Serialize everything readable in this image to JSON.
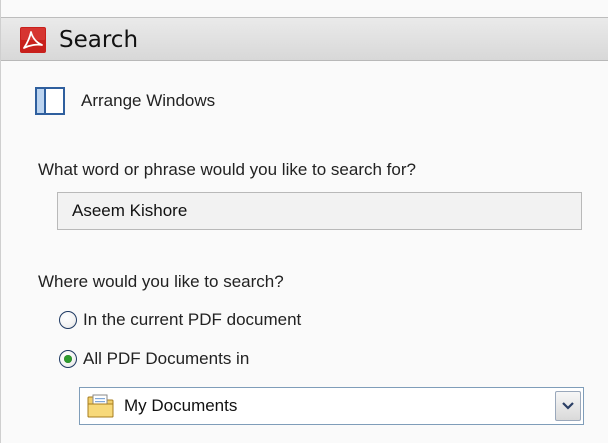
{
  "window": {
    "title": "Search"
  },
  "arrange": {
    "label": "Arrange Windows",
    "icon": "arrange-windows-icon"
  },
  "search": {
    "prompt": "What word or phrase would you like to search for?",
    "value": "Aseem Kishore"
  },
  "location": {
    "prompt": "Where would you like to search?",
    "options": [
      {
        "label": "In the current PDF document",
        "selected": false
      },
      {
        "label": "All PDF Documents in",
        "selected": true
      }
    ],
    "folder": {
      "value": "My Documents",
      "icon": "folder-icon"
    }
  },
  "colors": {
    "acrobat_red": "#c8201c",
    "radio_checked": "#2e9c2e",
    "select_border": "#7f9db9"
  }
}
